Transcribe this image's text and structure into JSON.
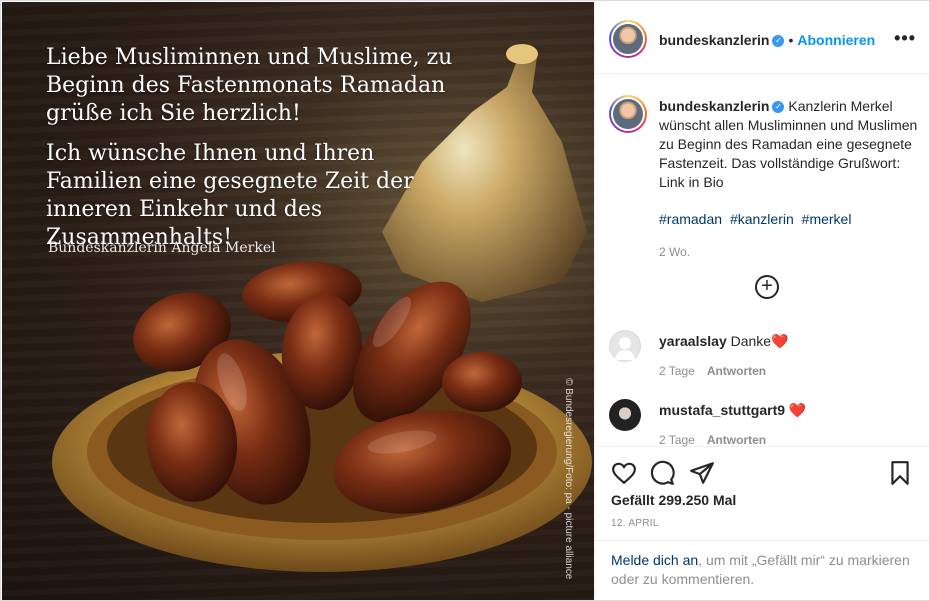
{
  "image": {
    "overlay_paragraphs": [
      "Liebe Musliminnen und Muslime, zu Beginn des Fastenmonats Ramadan grüße ich Sie herzlich!",
      "Ich wünsche Ihnen und Ihren Familien eine gesegnete Zeit der inneren Einkehr und des Zusammenhalts!"
    ],
    "signature": "Bundeskanzlerin Angela Merkel",
    "credit": "© Bundesregierung/Foto: pa - picture alliance"
  },
  "header": {
    "username": "bundeskanzlerin",
    "separator": "•",
    "follow_label": "Abonnieren",
    "more_label": "•••"
  },
  "caption": {
    "username": "bundeskanzlerin",
    "text": "Kanzlerin Merkel wünscht allen Musliminnen und Muslimen zu Beginn des Ramadan eine gesegnete Fastenzeit. Das vollständige Grußwort: Link in Bio",
    "hashtags": [
      "#ramadan",
      "#kanzlerin",
      "#merkel"
    ],
    "timestamp": "2 Wo."
  },
  "load_more_label": "+",
  "comments": [
    {
      "username": "yaraalslay",
      "text": "Danke",
      "emoji": "❤️",
      "time": "2 Tage",
      "reply_label": "Antworten"
    },
    {
      "username": "mustafa_stuttgart9",
      "text": "",
      "emoji": "❤️",
      "time": "2 Tage",
      "reply_label": "Antworten"
    }
  ],
  "likes_text": "Gefällt 299.250 Mal",
  "date_text": "12. APRIL",
  "login_prompt": {
    "link_text": "Melde dich an",
    "rest_text": ", um mit „Gefällt mir“ zu markieren oder zu kommentieren."
  },
  "colors": {
    "accent": "#0095f6",
    "hashtag": "#00376b",
    "muted": "#8e8e8e",
    "heart": "#ed4956"
  },
  "icons": [
    "heart-icon",
    "comment-icon",
    "share-icon",
    "bookmark-icon",
    "verified-badge-icon",
    "more-options-icon",
    "add-circle-icon"
  ]
}
